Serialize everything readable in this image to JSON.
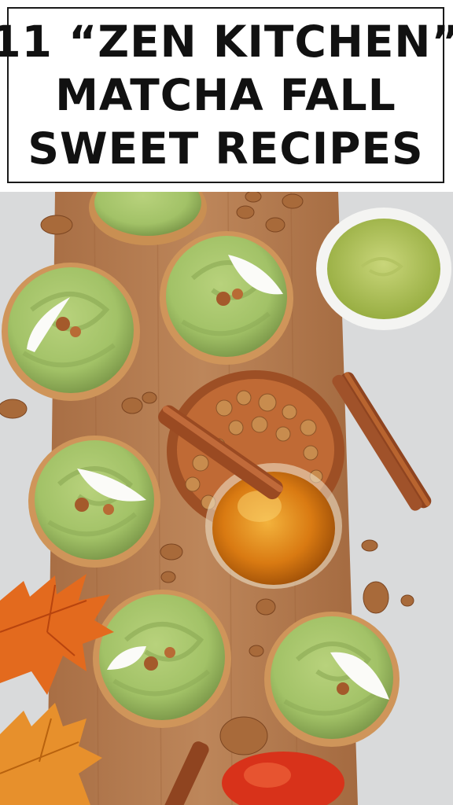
{
  "title": {
    "line1": "11 “ZEN KITCHEN”",
    "line2": "MATCHA FALL",
    "line3": "SWEET RECIPES"
  },
  "photo": {
    "subject": "matcha-cupcakes-flatlay",
    "colors": {
      "surface": "#d9dadb",
      "board": "#b27a4e",
      "frosting": "#a5c46a",
      "cream": "#fbfbf8",
      "honey": "#e08f1f",
      "leaf": "#e06a1c",
      "cinnamon": "#9c4a22"
    }
  }
}
